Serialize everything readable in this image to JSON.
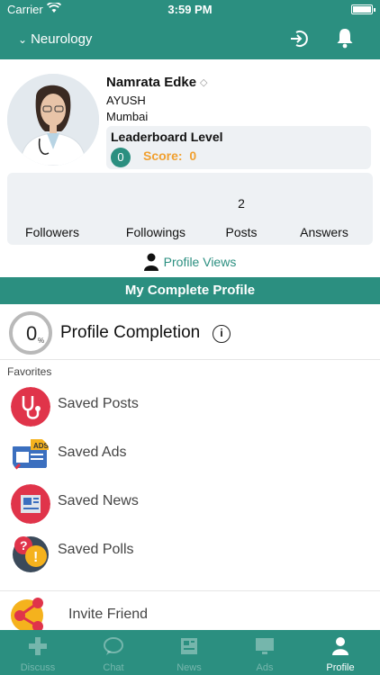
{
  "status_bar": {
    "carrier": "Carrier",
    "time": "3:59 PM"
  },
  "header": {
    "specialty": "Neurology"
  },
  "profile": {
    "name": "Namrata Edke",
    "organization": "AYUSH",
    "city": "Mumbai"
  },
  "leaderboard": {
    "title": "Leaderboard Level",
    "level": "0",
    "score_label": "Score:",
    "score_value": "0"
  },
  "stats": [
    {
      "label": "Followers",
      "value": ""
    },
    {
      "label": "Followings",
      "value": ""
    },
    {
      "label": "Posts",
      "value": "2"
    },
    {
      "label": "Answers",
      "value": ""
    }
  ],
  "profile_views": "Profile Views",
  "section_title": "My Complete Profile",
  "completion": {
    "title": "Profile Completion",
    "percent": "0",
    "percent_sign": "%"
  },
  "favorites": {
    "label": "Favorites",
    "items": [
      "Saved Posts",
      "Saved Ads",
      "Saved News",
      "Saved Polls"
    ]
  },
  "invite": "Invite Friend",
  "tabs": [
    {
      "label": "Discuss",
      "icon": "plus-icon"
    },
    {
      "label": "Chat",
      "icon": "chat-bubble-icon"
    },
    {
      "label": "News",
      "icon": "newspaper-icon"
    },
    {
      "label": "Ads",
      "icon": "monitor-icon"
    },
    {
      "label": "Profile",
      "icon": "person-icon",
      "active": true
    }
  ],
  "colors": {
    "brand": "#2b8f80",
    "score": "#f0a030",
    "card": "#eef1f4"
  }
}
